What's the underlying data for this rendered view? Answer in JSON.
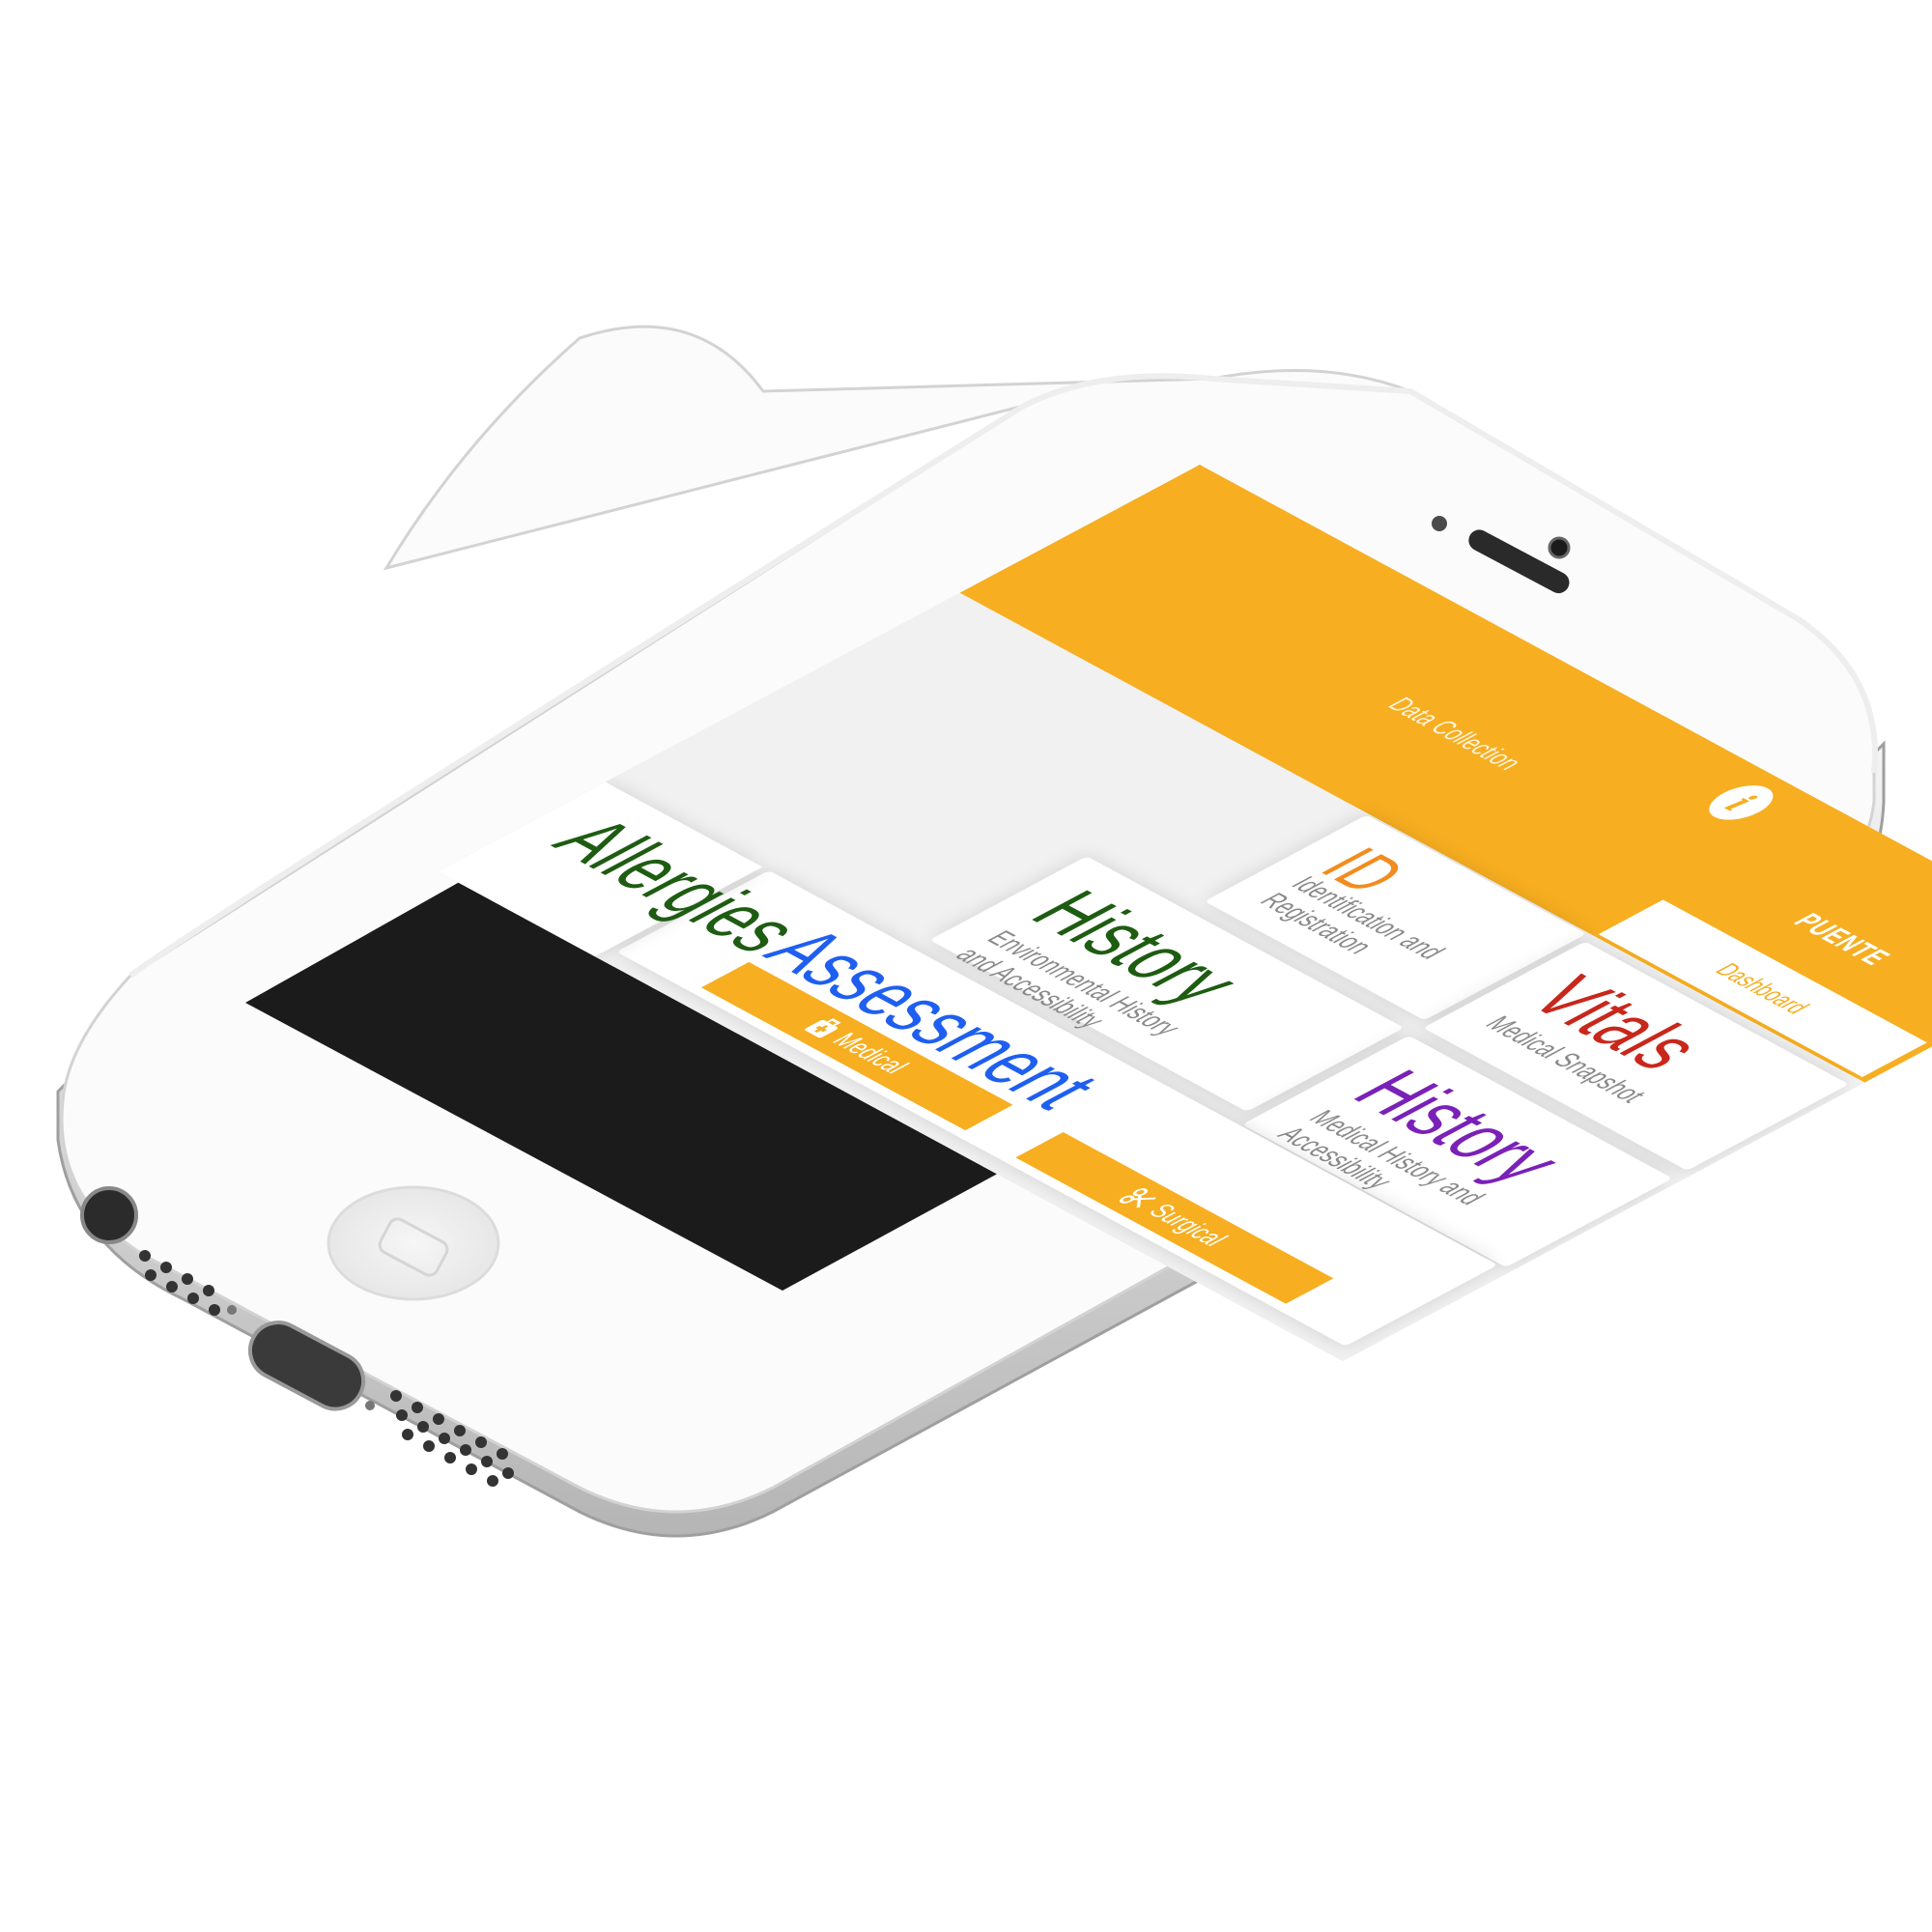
{
  "header": {
    "info_icon": "i",
    "app_title": "PUENTE",
    "tabs": [
      {
        "label": "Data Collection",
        "active": false
      },
      {
        "label": "Dashboard",
        "active": true
      }
    ],
    "logout_icon": "logout-icon",
    "color": "#f7ae20"
  },
  "cards": {
    "id": {
      "title": "ID",
      "subtitle": "Identification and Registration",
      "color": "#f28c1e"
    },
    "vitals": {
      "title": "Vitals",
      "subtitle": "Medical Snapshot",
      "color": "#c8271b"
    },
    "env_history": {
      "title": "History",
      "subtitle": "Environmental History and Accessibility",
      "color": "#1e5c12"
    },
    "med_history": {
      "title": "History",
      "subtitle": "Medical History and Accessibility",
      "color": "#7a21b8"
    },
    "assessment": {
      "title": "Assessment",
      "color": "#1f5ff0",
      "buttons": [
        {
          "label": "Medical",
          "icon": "medkit-icon"
        },
        {
          "label": "Surgical",
          "icon": "scissors-icon"
        }
      ]
    },
    "allergies": {
      "title": "Allergies",
      "color": "#1e5c12"
    }
  }
}
